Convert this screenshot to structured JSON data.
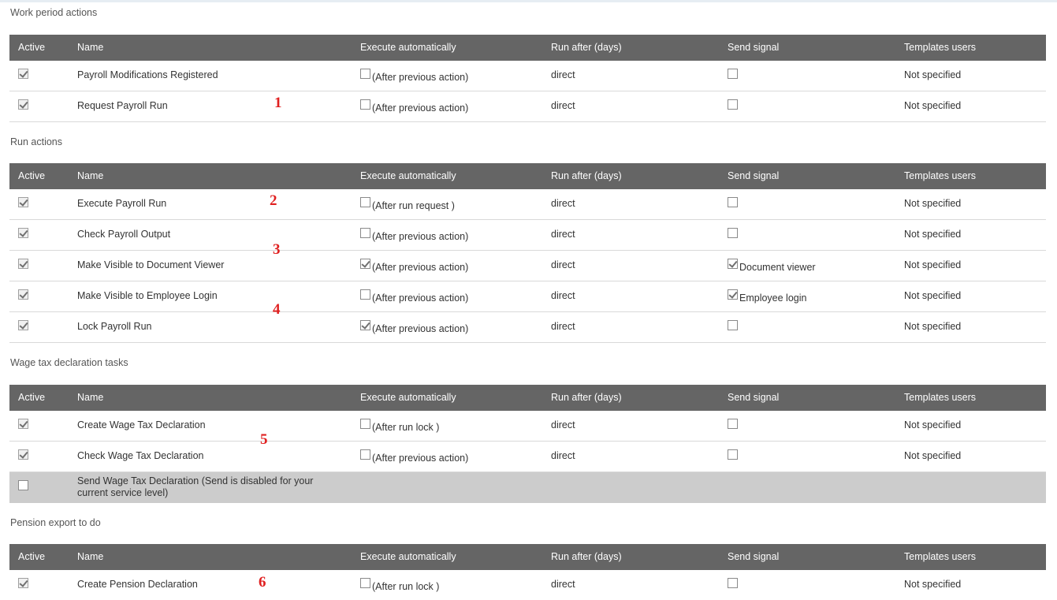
{
  "headers": {
    "active": "Active",
    "name": "Name",
    "exec": "Execute automatically",
    "run": "Run after (days)",
    "signal": "Send signal",
    "templates": "Templates users"
  },
  "sections": [
    {
      "title": "Work period actions",
      "rows": [
        {
          "active": true,
          "name": "Payroll Modifications Registered",
          "exec_checked": false,
          "exec_label": "(After previous action)",
          "run": "direct",
          "signal_checked": false,
          "signal_label": "",
          "templates": "Not specified"
        },
        {
          "active": true,
          "name": "Request Payroll Run",
          "exec_checked": false,
          "exec_label": "(After previous action)",
          "run": "direct",
          "signal_checked": false,
          "signal_label": "",
          "templates": "Not specified"
        }
      ]
    },
    {
      "title": "Run actions",
      "rows": [
        {
          "active": true,
          "name": "Execute Payroll Run",
          "exec_checked": false,
          "exec_label": "(After run request )",
          "run": "direct",
          "signal_checked": false,
          "signal_label": "",
          "templates": "Not specified"
        },
        {
          "active": true,
          "name": "Check Payroll Output",
          "exec_checked": false,
          "exec_label": "(After previous action)",
          "run": "direct",
          "signal_checked": false,
          "signal_label": "",
          "templates": "Not specified"
        },
        {
          "active": true,
          "name": "Make Visible to Document Viewer",
          "exec_checked": true,
          "exec_label": "(After previous action)",
          "run": "direct",
          "signal_checked": true,
          "signal_label": "Document viewer",
          "templates": "Not specified"
        },
        {
          "active": true,
          "name": "Make Visible to Employee Login",
          "exec_checked": false,
          "exec_label": "(After previous action)",
          "run": "direct",
          "signal_checked": true,
          "signal_label": "Employee login",
          "templates": "Not specified"
        },
        {
          "active": true,
          "name": "Lock Payroll Run",
          "exec_checked": true,
          "exec_label": "(After previous action)",
          "run": "direct",
          "signal_checked": false,
          "signal_label": "",
          "templates": "Not specified"
        }
      ]
    },
    {
      "title": "Wage tax declaration tasks",
      "rows": [
        {
          "active": true,
          "name": "Create Wage Tax Declaration",
          "exec_checked": false,
          "exec_label": "(After run lock )",
          "run": "direct",
          "signal_checked": false,
          "signal_label": "",
          "templates": "Not specified"
        },
        {
          "active": true,
          "name": "Check Wage Tax Declaration",
          "exec_checked": false,
          "exec_label": "(After previous action)",
          "run": "direct",
          "signal_checked": false,
          "signal_label": "",
          "templates": "Not specified"
        },
        {
          "active": false,
          "disabled": true,
          "name": "Send Wage Tax Declaration (Send is disabled for your current service level)"
        }
      ]
    },
    {
      "title": "Pension export to do",
      "rows": [
        {
          "active": true,
          "name": "Create Pension Declaration",
          "exec_checked": false,
          "exec_label": "(After run lock )",
          "run": "direct",
          "signal_checked": false,
          "signal_label": "",
          "templates": "Not specified"
        }
      ]
    }
  ],
  "annotations": [
    "1",
    "2",
    "3",
    "4",
    "5",
    "6"
  ]
}
